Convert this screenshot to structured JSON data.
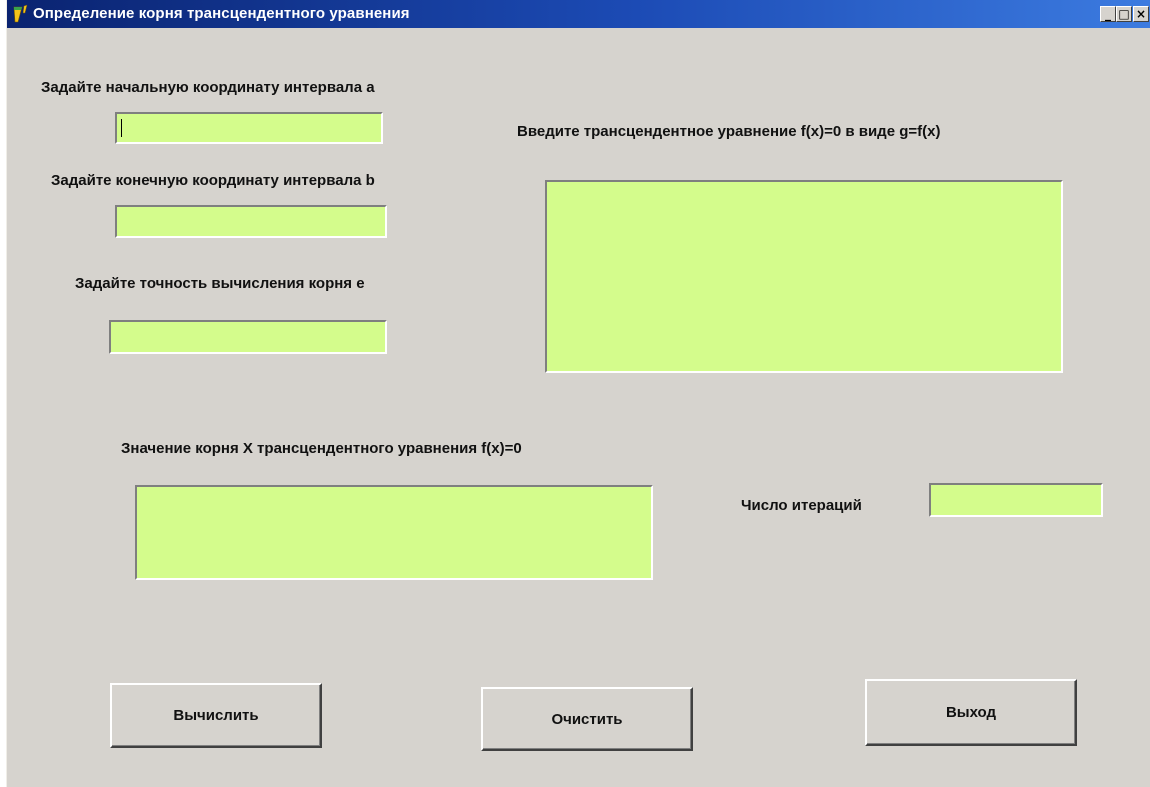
{
  "window": {
    "title": "Определение корня трансцендентного уравнения",
    "minimize_glyph": "_",
    "maximize_glyph": "□",
    "close_glyph": "×"
  },
  "labels": {
    "start_a": "Задайте начальную координату интервала  a",
    "end_b": "Задайте конечную координату интервала   b",
    "precision_e": "Задайте точность вычисления корня  e",
    "equation": "Введите трансцендентное уравнение f(x)=0 в виде  g=f(x)",
    "root_value": "Значение корня  X  трансцендентного уравнения  f(x)=0",
    "iterations": "Число итераций"
  },
  "fields": {
    "start_a": "",
    "end_b": "",
    "precision_e": "",
    "equation": "",
    "root_value": "",
    "iterations": ""
  },
  "buttons": {
    "calculate": "Вычислить",
    "clear": "Очистить",
    "exit": "Выход"
  },
  "colors": {
    "field_background": "#d4fc8c",
    "window_background": "#d6d3ce",
    "titlebar_start": "#0a2370",
    "titlebar_end": "#3c7be0"
  },
  "icons": {
    "app": "delphi-app-icon"
  }
}
